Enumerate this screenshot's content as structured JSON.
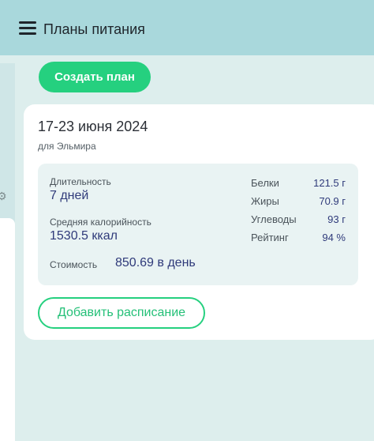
{
  "header": {
    "title": "Планы питания",
    "menu_icon": "hamburger-menu-icon"
  },
  "actions": {
    "create_plan_label": "Создать план",
    "add_schedule_label": "Добавить расписание"
  },
  "plan": {
    "dates": "17-23 июня 2024",
    "for_person": "для Эльмира",
    "duration_label": "Длительность",
    "duration_value": "7 дней",
    "calories_label": "Средняя калорийность",
    "calories_value": "1530.5 ккал",
    "cost_label": "Стоимость",
    "cost_value": "850.69 в день",
    "macros": [
      {
        "label": "Белки",
        "value": "121.5 г"
      },
      {
        "label": "Жиры",
        "value": "70.9 г"
      },
      {
        "label": "Углеводы",
        "value": "93 г"
      },
      {
        "label": "Рейтинг",
        "value": "94 %"
      }
    ]
  },
  "colors": {
    "header_bg": "#a9d8dc",
    "page_bg": "#ddeeed",
    "accent_green": "#25d07f",
    "value_blue": "#2f3a7a",
    "stats_bg": "#e9f3f3"
  }
}
